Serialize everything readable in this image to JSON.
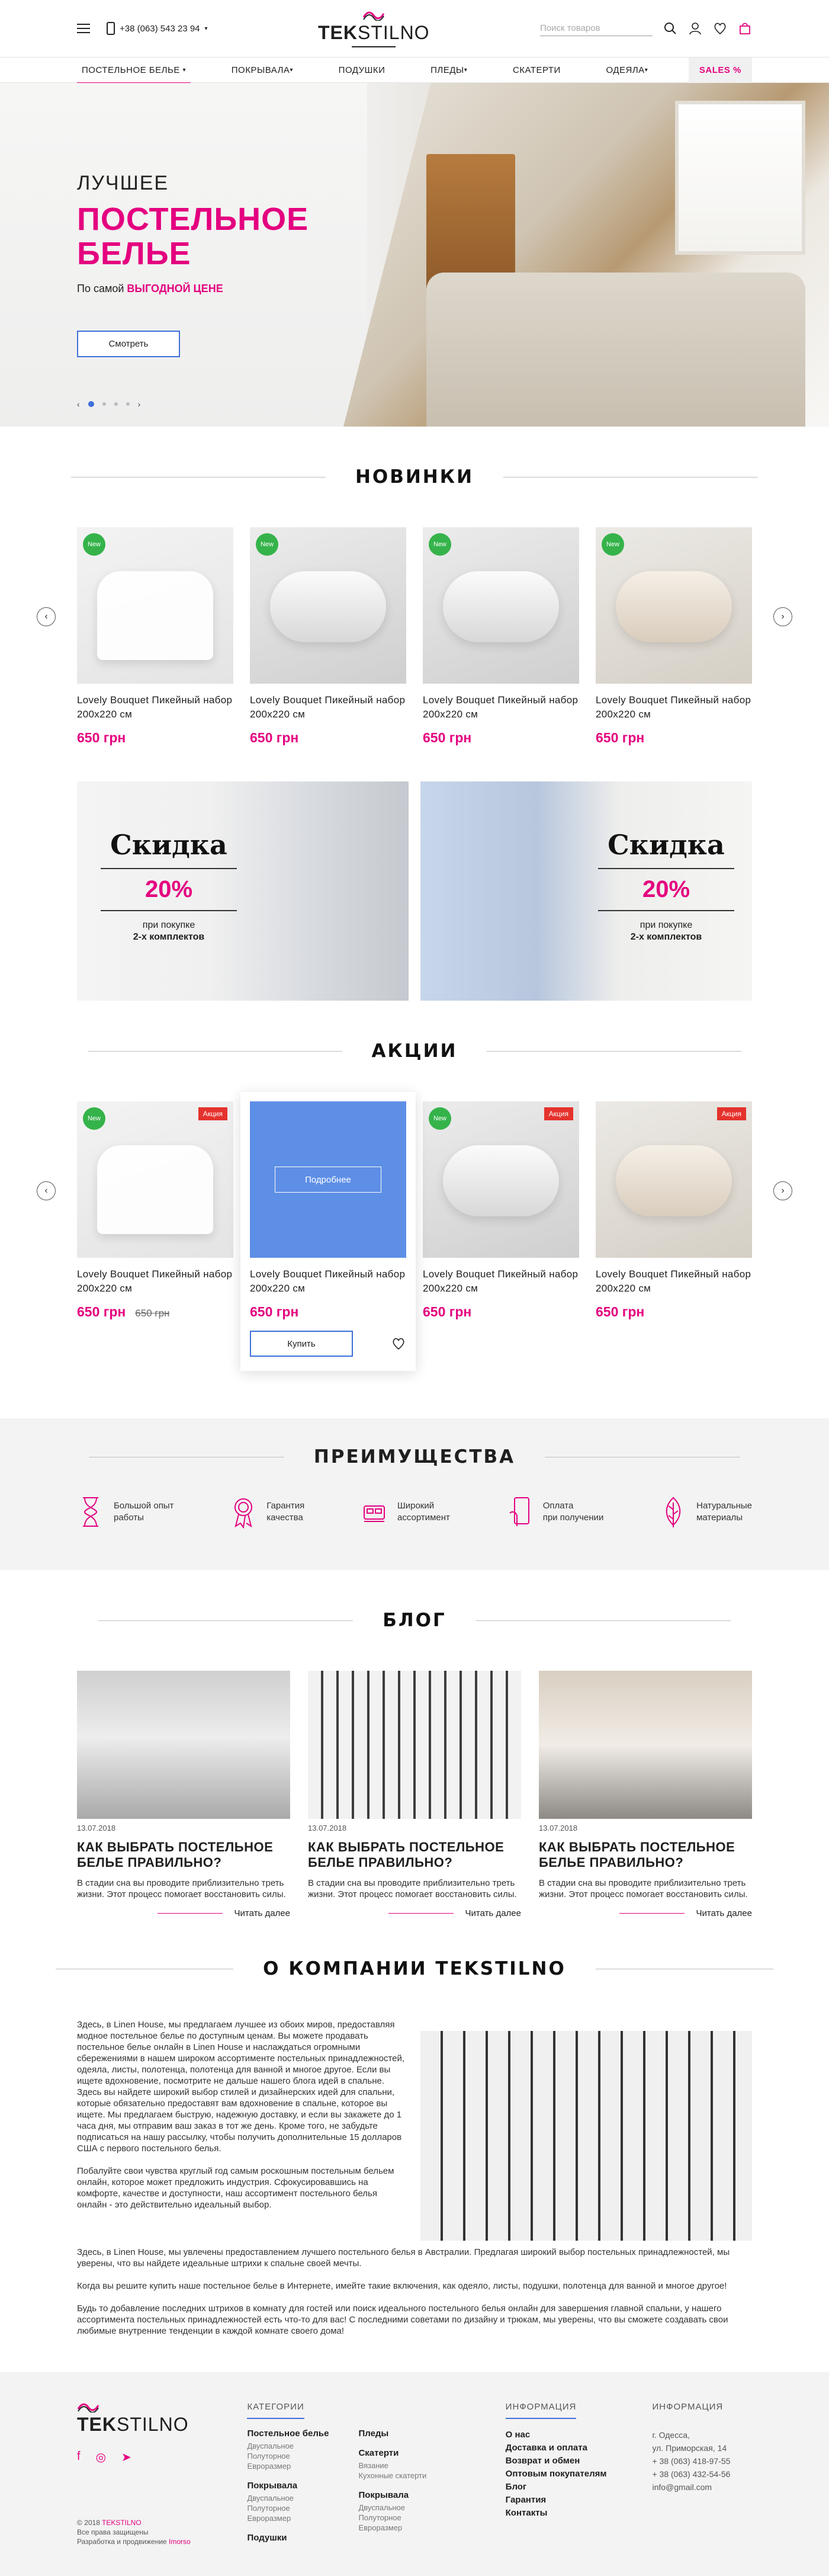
{
  "header": {
    "phone": "+38 (063) 543 23 94",
    "logo_bold": "TEK",
    "logo_light": "STILNO",
    "search_placeholder": "Поиск товаров",
    "icons": [
      "menu-icon",
      "phone-icon",
      "search-icon",
      "user-icon",
      "heart-icon",
      "cart-icon"
    ]
  },
  "nav": [
    {
      "label": "ПОСТЕЛЬНОЕ БЕЛЬЕ",
      "caret": "▾",
      "active": true
    },
    {
      "label": "ПОКРЫВАЛА",
      "caret": "▾"
    },
    {
      "label": "ПОДУШКИ",
      "caret": ""
    },
    {
      "label": "ПЛЕДЫ",
      "caret": "▾"
    },
    {
      "label": "СКАТЕРТИ",
      "caret": ""
    },
    {
      "label": "ОДЕЯЛА",
      "caret": "▾"
    },
    {
      "label": "SALES %",
      "caret": ""
    }
  ],
  "hero": {
    "sub": "ЛУЧШЕЕ",
    "title_1": "ПОСТЕЛЬНОЕ",
    "title_2": "БЕЛЬЕ",
    "desc_plain": "По самой",
    "desc_pink": "ВЫГОДНОЙ ЦЕНЕ",
    "button": "Смотреть",
    "arrow_left": "‹",
    "arrow_right": "›"
  },
  "new_section": {
    "title": "НОВИНКИ",
    "products": [
      {
        "name": "Lovely Bouquet Пикейный набор 200х220 см",
        "price": "650 грн",
        "badge": "New"
      },
      {
        "name": "Lovely Bouquet Пикейный набор 200х220 см",
        "price": "650 грн",
        "badge": "New"
      },
      {
        "name": "Lovely Bouquet Пикейный набор 200х220 см",
        "price": "650 грн",
        "badge": "New"
      },
      {
        "name": "Lovely Bouquet Пикейный набор 200х220 см",
        "price": "650 грн",
        "badge": "New"
      }
    ]
  },
  "promos": [
    {
      "title": "Скидка",
      "percent": "20%",
      "note_1": "при покупке",
      "note_2": "2-х комплектов"
    },
    {
      "title": "Скидка",
      "percent": "20%",
      "note_1": "при покупке",
      "note_2": "2-х комплектов"
    }
  ],
  "sale_section": {
    "title": "АКЦИИ",
    "details_label": "Подробнее",
    "buy_label": "Купить",
    "products": [
      {
        "name": "Lovely Bouquet Пикейный набор 200х220 см",
        "price": "650 грн",
        "old_price": "650 грн",
        "badge_new": "New",
        "badge_sale": "Акция"
      },
      {
        "name": "Lovely Bouquet Пикейный набор 200х220 см",
        "price": "650 грн"
      },
      {
        "name": "Lovely Bouquet Пикейный набор 200х220 см",
        "price": "650 грн",
        "badge_new": "New",
        "badge_sale": "Акция"
      },
      {
        "name": "Lovely Bouquet Пикейный набор 200х220 см",
        "price": "650 грн",
        "badge_sale": "Акция"
      }
    ]
  },
  "advantages": {
    "title": "ПРЕИМУЩЕСТВА",
    "items": [
      {
        "l1": "Большой опыт",
        "l2": "работы"
      },
      {
        "l1": "Гарантия",
        "l2": "качества"
      },
      {
        "l1": "Широкий",
        "l2": "ассортимент"
      },
      {
        "l1": "Оплата",
        "l2": "при получении"
      },
      {
        "l1": "Натуральные",
        "l2": "материалы"
      }
    ]
  },
  "blog": {
    "title": "БЛОГ",
    "read_more": "Читать далее",
    "posts": [
      {
        "date": "13.07.2018",
        "title": "КАК ВЫБРАТЬ ПОСТЕЛЬНОЕ БЕЛЬЕ ПРАВИЛЬНО?",
        "text": "В стадии сна вы проводите приблизительно треть жизни. Этот процесс помогает восстановить силы."
      },
      {
        "date": "13.07.2018",
        "title": "КАК ВЫБРАТЬ ПОСТЕЛЬНОЕ БЕЛЬЕ ПРАВИЛЬНО?",
        "text": "В стадии сна вы проводите приблизительно треть жизни. Этот процесс помогает восстановить силы."
      },
      {
        "date": "13.07.2018",
        "title": "КАК ВЫБРАТЬ ПОСТЕЛЬНОЕ БЕЛЬЕ ПРАВИЛЬНО?",
        "text": "В стадии сна вы проводите приблизительно треть жизни. Этот процесс помогает восстановить силы."
      }
    ]
  },
  "about": {
    "title": "О КОМПАНИИ TEKSTILNO",
    "p1": "Здесь, в Linen House, мы предлагаем лучшее из обоих миров, предоставляя модное постельное белье по доступным ценам. Вы можете продавать постельное белье онлайн в Linen House и наслаждаться огромными сбережениями в нашем широком ассортименте постельных принадлежностей, одеяла, листы, полотенца, полотенца для ванной и многое другое. Если вы ищете вдохновение, посмотрите не дальше нашего блога идей в спальне. Здесь вы найдете широкий выбор стилей и дизайнерских идей для спальни, которые обязательно предоставят вам вдохновение в спальне, которое вы ищете. Мы предлагаем быструю, надежную доставку, и если вы закажете до 1 часа дня, мы отправим ваш заказ в тот же день. Кроме того, не забудьте подписаться на нашу рассылку, чтобы получить дополнительные 15 долларов США с первого постельного белья.",
    "p2": "Побалуйте свои чувства круглый год самым роскошным постельным бельем онлайн, которое может предложить индустрия. Сфокусировавшись на комфорте, качестве и доступности, наш ассортимент постельного белья онлайн - это действительно идеальный выбор.",
    "p3": "Здесь, в Linen House, мы увлечены предоставлением лучшего постельного белья в Австралии. Предлагая широкий выбор постельных принадлежностей, мы уверены, что вы найдете идеальные штрихи к спальне своей мечты.",
    "p4": "Когда вы решите купить наше постельное белье в Интернете, имейте такие включения, как одеяло, листы, подушки, полотенца для ванной и многое другое!",
    "p5": "Будь то добавление последних штрихов в комнату для гостей или поиск идеального постельного белья онлайн для завершения главной спальни, у нашего ассортимента постельных принадлежностей есть что-то для вас! С последними советами по дизайну и трюкам, мы уверены, что вы сможете создавать свои любимые внутренние тенденции в каждой комнате своего дома!"
  },
  "footer": {
    "copy_1": "© 2018",
    "copy_brand": "TEKSTILNO",
    "copy_2": "Все права защищены",
    "copy_3": "Разработка и продвижение",
    "copy_dev": "Imorso",
    "categories_head": "КАТЕГОРИИ",
    "categories": [
      [
        {
          "name": "Постельное белье",
          "subs": [
            "Двуспальное",
            "Полуторное",
            "Евроразмер"
          ]
        },
        {
          "name": "Покрывала",
          "subs": [
            "Двуспальное",
            "Полуторное",
            "Евроразмер"
          ]
        },
        {
          "name": "Подушки",
          "subs": []
        }
      ],
      [
        {
          "name": "Пледы",
          "subs": []
        },
        {
          "name": "Скатерти",
          "subs": [
            "Вязание",
            "Кухонные скатерти"
          ]
        },
        {
          "name": "Покрывала",
          "subs": [
            "Двуспальное",
            "Полуторное",
            "Евроразмер"
          ]
        }
      ]
    ],
    "info_head": "ИНФОРМАЦИЯ",
    "info_links": [
      "О нас",
      "Доставка и оплата",
      "Возврат и обмен",
      "Оптовым покупателям",
      "Блог",
      "Гарантия",
      "Контакты"
    ],
    "contact_head": "ИНФОРМАЦИЯ",
    "contacts": [
      "г. Одесса,",
      "ул. Приморская, 14",
      "+ 38 (063) 418-97-55",
      "+ 38 (063) 432-54-56",
      "info@gmail.com"
    ]
  },
  "colors": {
    "accent": "#e4007f",
    "blue": "#3e6fd8",
    "new_badge": "#35b34a",
    "sale_badge": "#e5322d"
  }
}
